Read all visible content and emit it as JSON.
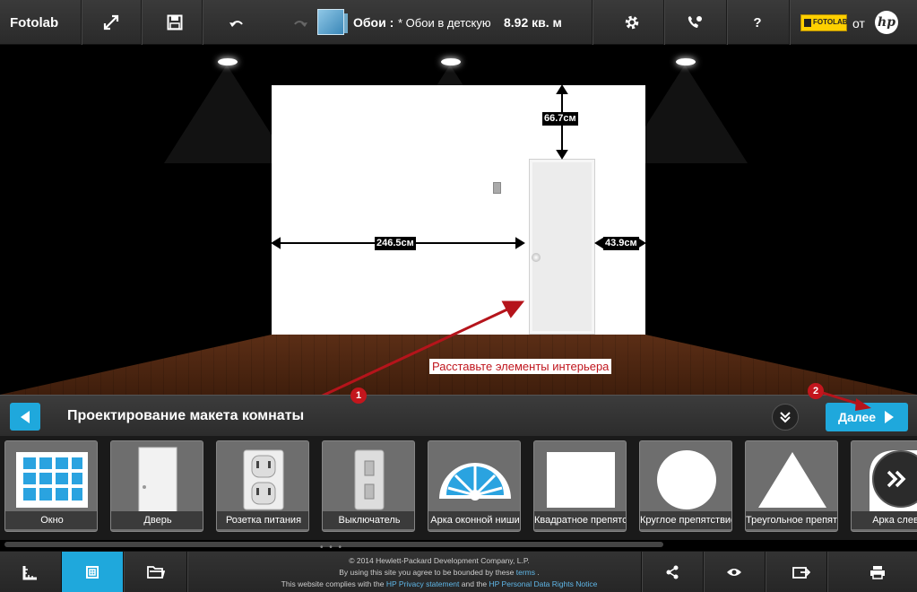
{
  "app": {
    "brand": "Fotolab",
    "project_label": "Обои :",
    "project_name": "* Обои в детскую",
    "area": "8.92 кв. м",
    "partner_label": "FOTOLAB",
    "by_label": "от",
    "hp_logo": "hp"
  },
  "toolbar": {
    "icons": [
      "fullscreen-icon",
      "save-icon",
      "undo-icon",
      "redo-icon",
      "gear-icon",
      "support-icon",
      "help-icon"
    ],
    "help_label": "?"
  },
  "scene": {
    "dim_left": "246.5см",
    "dim_top": "66.7см",
    "dim_right": "43.9см",
    "hint": "Расставьте элементы интерьера",
    "badge_1": "1",
    "badge_2": "2",
    "arrow_color": "#b5141b"
  },
  "panel": {
    "title": "Проектирование макета комнаты",
    "next_label": "Далее",
    "accent": "#1fa8dc"
  },
  "elements": [
    {
      "label": "Окно",
      "icon": "window-icon"
    },
    {
      "label": "Дверь",
      "icon": "door-icon"
    },
    {
      "label": "Розетка питания",
      "icon": "power-outlet-icon"
    },
    {
      "label": "Выключатель",
      "icon": "light-switch-icon"
    },
    {
      "label": "Арка оконной ниши",
      "icon": "arch-window-icon"
    },
    {
      "label": "Квадратное препятствие",
      "icon": "square-icon"
    },
    {
      "label": "Круглое препятствие",
      "icon": "circle-icon"
    },
    {
      "label": "Треугольное препятствие",
      "icon": "triangle-icon"
    },
    {
      "label": "Арка слева",
      "icon": "arch-icon"
    }
  ],
  "footer": {
    "line1": "© 2014 Hewlett-Packard Development Company, L.P.",
    "line2_pre": "By using this site you agree to be bounded by these",
    "terms": "terms",
    "line2_post": ".",
    "line3_pre": "This website complies with the",
    "privacy": "HP Privacy statement",
    "line3_mid": "and the",
    "personal": "HP Personal Data Rights Notice"
  }
}
